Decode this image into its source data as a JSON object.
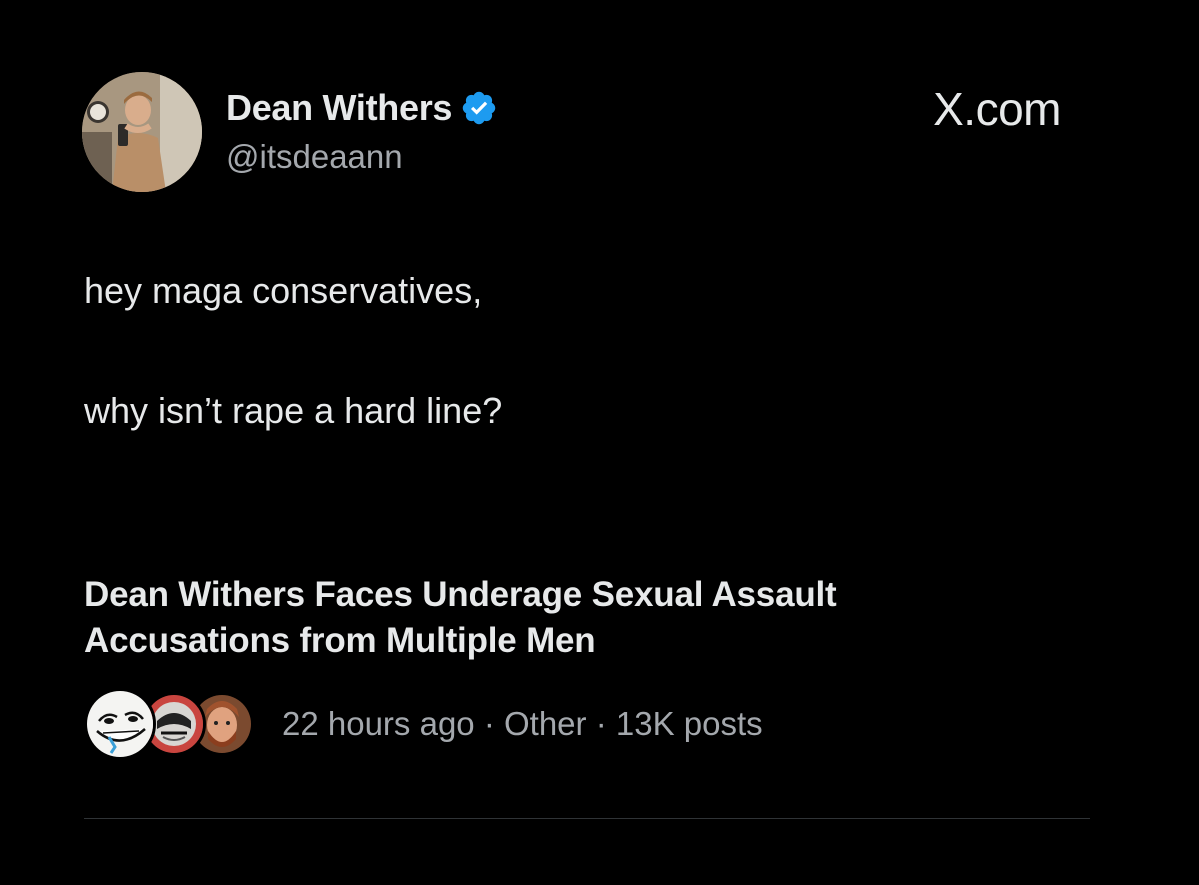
{
  "post": {
    "author": {
      "display_name": "Dean Withers",
      "handle": "@itsdeaann",
      "verified": true,
      "verified_badge_color": "#1d9bf0",
      "avatar_icon": "profile-photo"
    },
    "brand": "X.com",
    "lines": [
      "hey maga conservatives,",
      "why isn’t rape a hard line?"
    ]
  },
  "trend": {
    "headline_line1": "Dean Withers Faces Underage Sexual Assault",
    "headline_line2": "Accusations from Multiple Men",
    "time": "22 hours ago",
    "category": "Other",
    "posts": "13K posts",
    "separator": " · "
  },
  "colors": {
    "background": "#000000",
    "primary_text": "#e7e9ea",
    "secondary_text": "#a4a8ad",
    "divider": "#2f3336"
  }
}
